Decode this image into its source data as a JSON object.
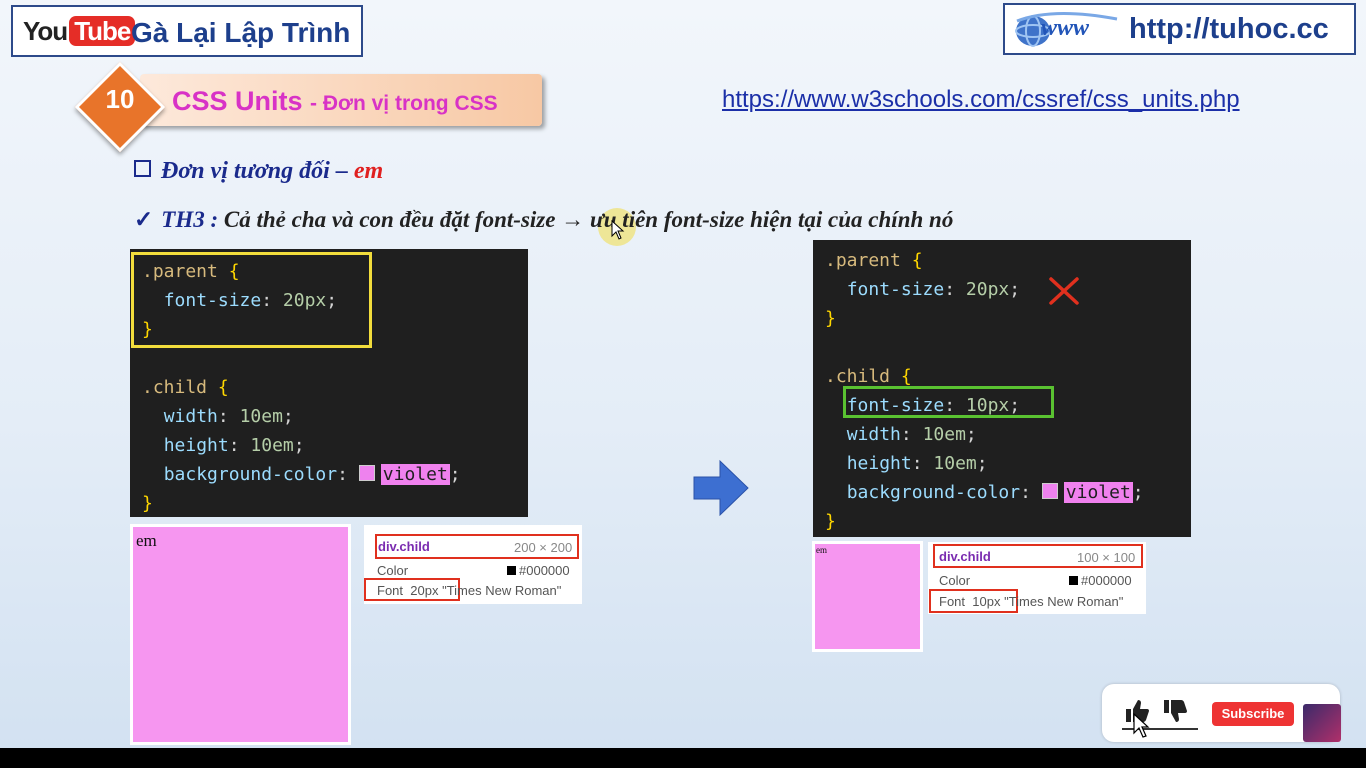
{
  "header": {
    "youtube_logo_you": "You",
    "youtube_logo_tube": "Tube",
    "channel_name": "Gà Lại Lập Trình",
    "website_logo_text": "www",
    "website_url": "http://tuhoc.cc"
  },
  "lesson": {
    "number": "10",
    "title": "CSS Units",
    "subtitle": "- Đơn vị trong CSS",
    "reference_url": "https://www.w3schools.com/cssref/css_units.php"
  },
  "bullets": {
    "topic_prefix": "Đơn vị tương đối – ",
    "topic_unit": "em",
    "case_label": "TH3 :",
    "case_text_1": "Cả thẻ cha và con đều đặt font-size",
    "case_arrow": "→",
    "case_text_2": "ưu tiên font-size hiện tại của chính nó"
  },
  "left_code": {
    "parent_selector": ".parent",
    "parent_font_prop": "font-size",
    "parent_font_val": "20px",
    "child_selector": ".child",
    "width_prop": "width",
    "width_val": "10em",
    "height_prop": "height",
    "height_val": "10em",
    "bg_prop": "background-color",
    "bg_val": "violet"
  },
  "right_code": {
    "parent_selector": ".parent",
    "parent_font_prop": "font-size",
    "parent_font_val": "20px",
    "child_selector": ".child",
    "child_font_prop": "font-size",
    "child_font_val": "10px",
    "width_prop": "width",
    "width_val": "10em",
    "height_prop": "height",
    "height_val": "10em",
    "bg_prop": "background-color",
    "bg_val": "violet"
  },
  "left_preview": {
    "box_text": "em",
    "tooltip_element": "div.child",
    "tooltip_size": "200 × 200",
    "color_label": "Color",
    "color_value": "#000000",
    "font_label": "Font",
    "font_size": "20px",
    "font_family": "\"Times New Roman\""
  },
  "right_preview": {
    "box_text": "em",
    "tooltip_element": "div.child",
    "tooltip_size": "100 × 100",
    "color_label": "Color",
    "color_value": "#000000",
    "font_label": "Font",
    "font_size": "10px",
    "font_family": "\"Times New Roman\""
  },
  "colors": {
    "accent_red": "#e0301e",
    "highlight_yellow": "#f2dd3c",
    "highlight_green": "#5ac231",
    "arrow_blue": "#3d6fd1",
    "violet": "#ee82ee"
  },
  "icons": [
    "thumbs-up-icon",
    "thumbs-down-icon",
    "cursor-icon",
    "cross-mark-icon",
    "right-arrow-icon",
    "www-globe-icon",
    "checkbox-square-icon",
    "checkmark-icon"
  ],
  "like_bar": {
    "subscribe_label": "Subscribe"
  }
}
